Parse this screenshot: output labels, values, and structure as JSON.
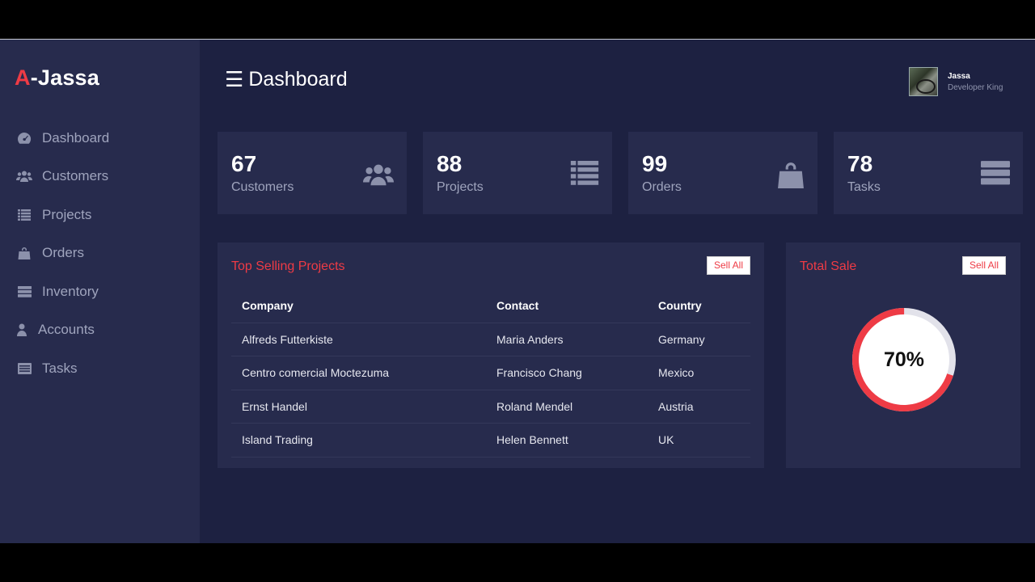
{
  "brand": {
    "accent_letter": "A",
    "rest": "-Jassa",
    "accent_color": "#ee3b45"
  },
  "sidebar": {
    "items": [
      {
        "label": "Dashboard",
        "icon": "tachometer-icon"
      },
      {
        "label": "Customers",
        "icon": "users-icon"
      },
      {
        "label": "Projects",
        "icon": "list-icon"
      },
      {
        "label": "Orders",
        "icon": "shopping-bag-icon"
      },
      {
        "label": "Inventory",
        "icon": "server-icon"
      },
      {
        "label": "Accounts",
        "icon": "user-icon"
      },
      {
        "label": "Tasks",
        "icon": "tasks-icon"
      }
    ]
  },
  "header": {
    "title": "Dashboard",
    "menu_icon": "☰"
  },
  "user": {
    "name": "Jassa",
    "role": "Developer King"
  },
  "cards": [
    {
      "value": "67",
      "label": "Customers",
      "icon": "users-icon"
    },
    {
      "value": "88",
      "label": "Projects",
      "icon": "list-icon"
    },
    {
      "value": "99",
      "label": "Orders",
      "icon": "shopping-bag-icon"
    },
    {
      "value": "78",
      "label": "Tasks",
      "icon": "server-icon"
    }
  ],
  "projects": {
    "title": "Top Selling Projects",
    "button": "Sell All",
    "columns": [
      "Company",
      "Contact",
      "Country"
    ],
    "rows": [
      [
        "Alfreds Futterkiste",
        "Maria Anders",
        "Germany"
      ],
      [
        "Centro comercial Moctezuma",
        "Francisco Chang",
        "Mexico"
      ],
      [
        "Ernst Handel",
        "Roland Mendel",
        "Austria"
      ],
      [
        "Island Trading",
        "Helen Bennett",
        "UK"
      ]
    ]
  },
  "total_sale": {
    "title": "Total Sale",
    "button": "Sell All",
    "percent_label": "70%",
    "percent": 70,
    "ring_color": "#ee3b45",
    "track_color": "#e2e2ea"
  }
}
